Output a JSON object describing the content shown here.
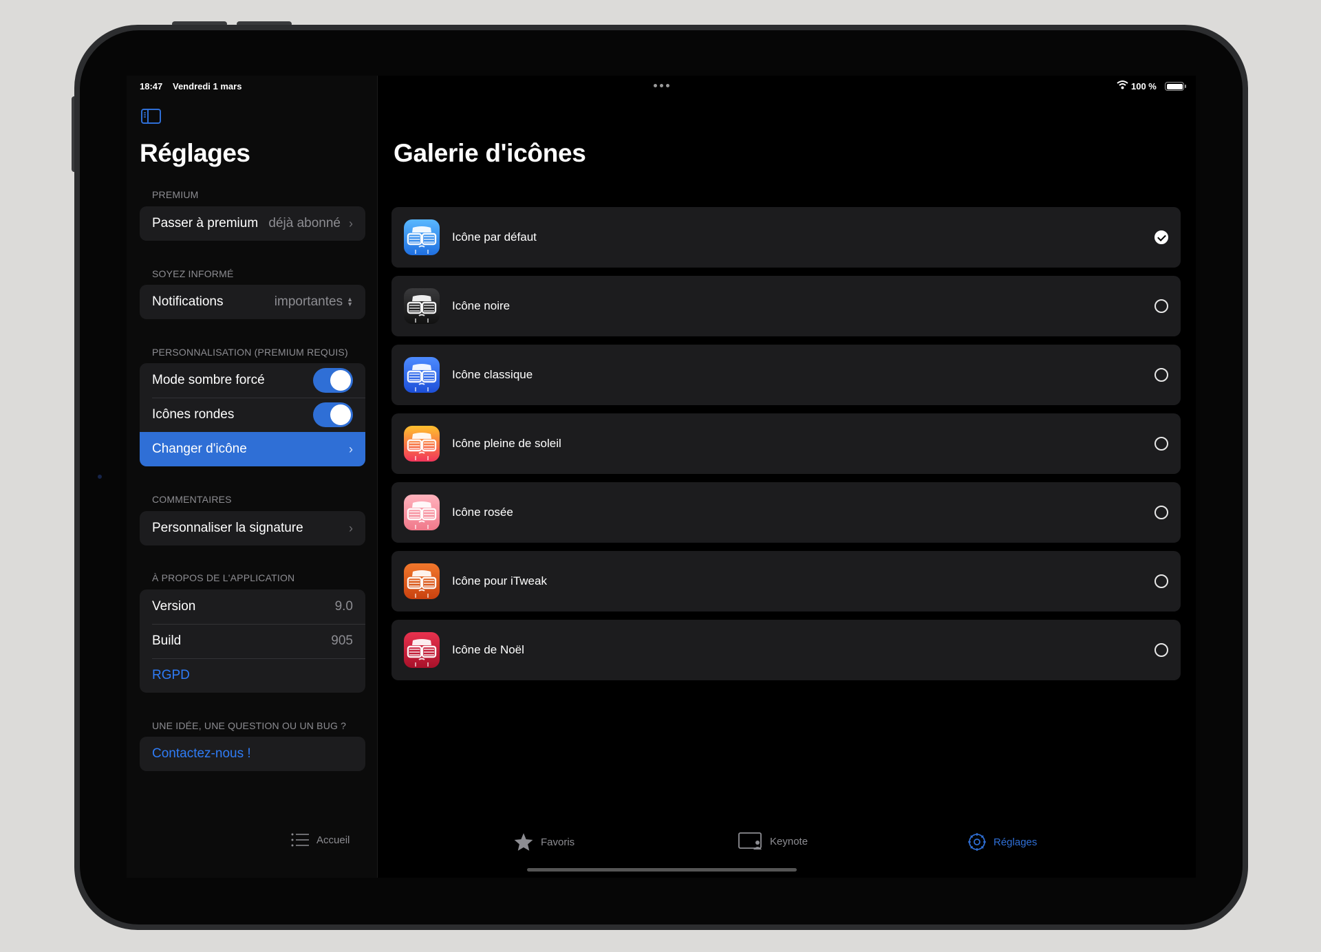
{
  "status_bar": {
    "time": "18:47",
    "date": "Vendredi 1 mars",
    "battery": "100 %"
  },
  "sidebar": {
    "title": "Réglages",
    "sections": {
      "premium": {
        "header": "PREMIUM",
        "row_label": "Passer à premium",
        "row_value": "déjà abonné"
      },
      "informed": {
        "header": "SOYEZ INFORMÉ",
        "row_label": "Notifications",
        "row_value": "importantes"
      },
      "personalization": {
        "header": "PERSONNALISATION (PREMIUM REQUIS)",
        "dark_mode_label": "Mode sombre forcé",
        "dark_mode_on": true,
        "round_icons_label": "Icônes rondes",
        "round_icons_on": true,
        "change_icon_label": "Changer d'icône"
      },
      "comments": {
        "header": "COMMENTAIRES",
        "row_label": "Personnaliser la signature"
      },
      "about": {
        "header": "À PROPOS DE L'APPLICATION",
        "version_label": "Version",
        "version_value": "9.0",
        "build_label": "Build",
        "build_value": "905",
        "rgpd_label": "RGPD"
      },
      "contact": {
        "header": "UNE IDÉE, UNE QUESTION OU UN BUG ?",
        "link_label": "Contactez-nous !"
      }
    }
  },
  "main": {
    "title": "Galerie d'icônes",
    "icons": [
      {
        "label": "Icône par défaut",
        "selected": true,
        "color_top": "#5ab8ff",
        "color_bottom": "#1f6fe0"
      },
      {
        "label": "Icône noire",
        "selected": false,
        "color_top": "#3a3a3c",
        "color_bottom": "#111111"
      },
      {
        "label": "Icône classique",
        "selected": false,
        "color_top": "#4d8bff",
        "color_bottom": "#1d4fd8"
      },
      {
        "label": "Icône pleine de soleil",
        "selected": false,
        "color_top": "#ffc02e",
        "color_bottom": "#f2355a"
      },
      {
        "label": "Icône rosée",
        "selected": false,
        "color_top": "#ffb3bd",
        "color_bottom": "#f0788a"
      },
      {
        "label": "Icône pour iTweak",
        "selected": false,
        "color_top": "#f2782c",
        "color_bottom": "#c9410f"
      },
      {
        "label": "Icône de Noël",
        "selected": false,
        "color_top": "#e8324e",
        "color_bottom": "#a8112a"
      }
    ]
  },
  "tab_bar": {
    "items": [
      {
        "label": "Accueil",
        "icon": "list-icon",
        "active": false
      },
      {
        "label": "Favoris",
        "icon": "star-icon",
        "active": false
      },
      {
        "label": "Keynote",
        "icon": "keynote-icon",
        "active": false
      },
      {
        "label": "Réglages",
        "icon": "gear-icon",
        "active": true
      }
    ]
  },
  "colors": {
    "accent": "#2f6fd6",
    "link": "#2f7cf6",
    "cell_background": "#1c1c1e"
  }
}
